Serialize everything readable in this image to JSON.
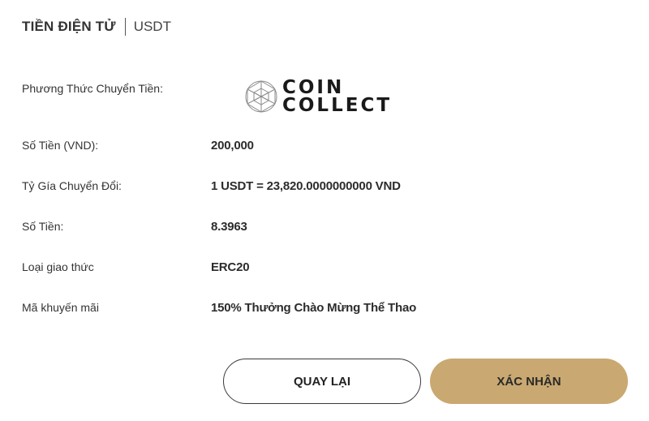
{
  "header": {
    "title": "TIỀN ĐIỆN TỬ",
    "subtitle": "USDT"
  },
  "details": [
    {
      "label": "Phương Thức Chuyển Tiền:",
      "value": ""
    },
    {
      "label": "Số Tiền (VND):",
      "value": "200,000"
    },
    {
      "label": "Tỷ Gía Chuyển Đổi:",
      "value": "1 USDT = 23,820.0000000000 VND"
    },
    {
      "label": "Số Tiền:",
      "value": "8.3963"
    },
    {
      "label": "Loại giao thức",
      "value": "ERC20"
    },
    {
      "label": "Mã khuyến mãi",
      "value": "150% Thưởng Chào Mừng Thể Thao"
    }
  ],
  "payment_logo": {
    "icon": "coincollect-logo-icon",
    "line1": "COIN",
    "line2": "COLLECT"
  },
  "buttons": {
    "back_label": "QUAY LẠI",
    "confirm_label": "XÁC NHẬN"
  },
  "colors": {
    "confirm_button": "#c9a971",
    "text": "#333333"
  }
}
